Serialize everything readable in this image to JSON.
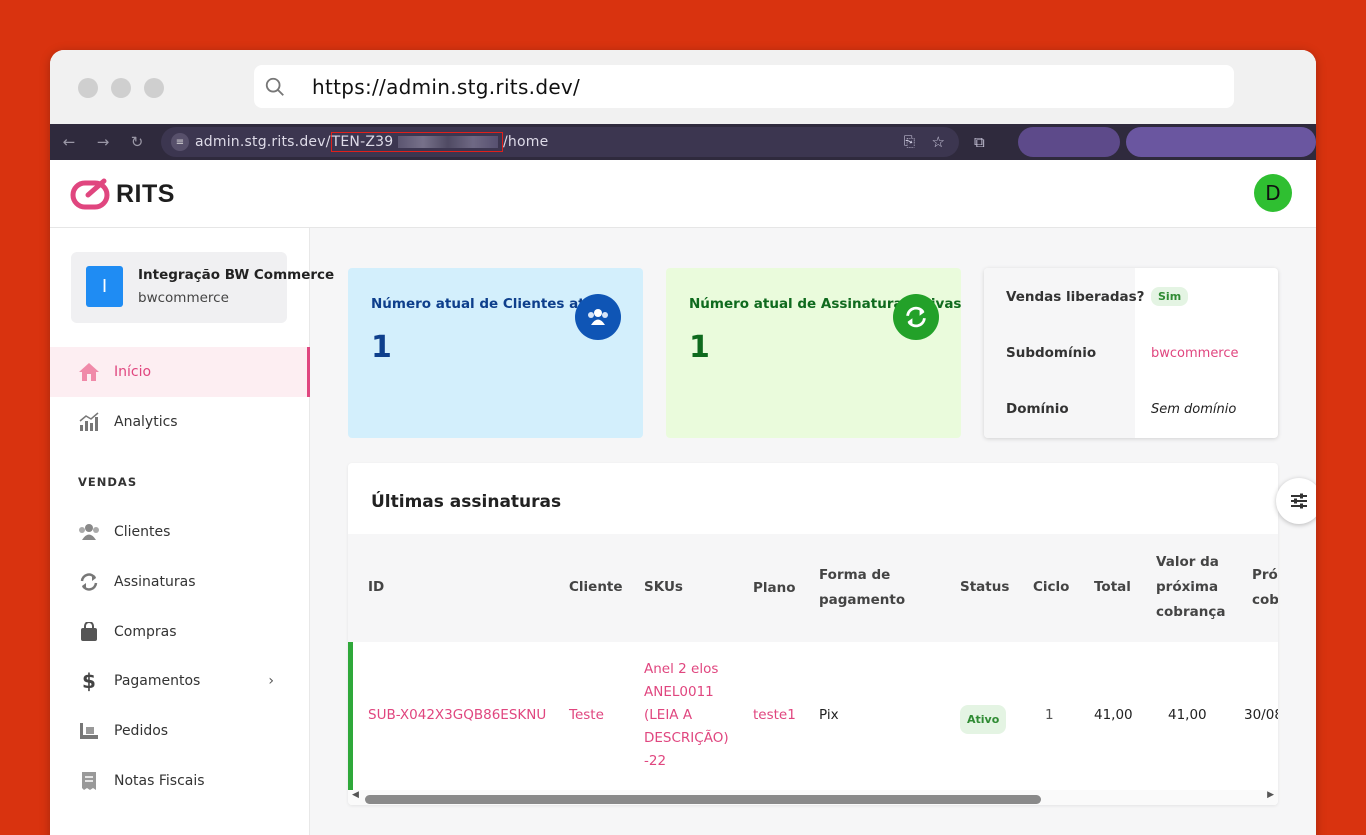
{
  "browser": {
    "url": "https://admin.stg.rits.dev/",
    "address_prefix": "admin.stg.rits.dev/",
    "address_tenant": "TEN-Z39",
    "address_suffix": "/home"
  },
  "header": {
    "logo_text": "RITS",
    "avatar_initial": "D"
  },
  "store": {
    "initial": "I",
    "name": "Integração BW Commerce",
    "slug": "bwcommerce"
  },
  "sidebar": {
    "items": [
      {
        "label": "Início",
        "icon": "home-icon"
      },
      {
        "label": "Analytics",
        "icon": "analytics-icon"
      }
    ],
    "section_vendas": "VENDAS",
    "vendas_items": [
      {
        "label": "Clientes",
        "icon": "users-icon"
      },
      {
        "label": "Assinaturas",
        "icon": "repeat-icon"
      },
      {
        "label": "Compras",
        "icon": "shopping-bag-icon"
      },
      {
        "label": "Pagamentos",
        "icon": "dollar-icon"
      },
      {
        "label": "Pedidos",
        "icon": "register-icon"
      },
      {
        "label": "Notas Fiscais",
        "icon": "receipt-icon"
      }
    ]
  },
  "cards": {
    "clientes": {
      "label": "Número atual de Clientes ativos",
      "value": "1"
    },
    "assinaturas": {
      "label": "Número atual de Assinaturas ativas",
      "value": "1"
    }
  },
  "info": {
    "vendas_label": "Vendas liberadas?",
    "vendas_value": "Sim",
    "subdominio_label": "Subdomínio",
    "subdominio_value": "bwcommerce",
    "dominio_label": "Domínio",
    "dominio_value": "Sem domínio"
  },
  "table": {
    "title": "Últimas assinaturas",
    "headers": {
      "id": "ID",
      "cliente": "Cliente",
      "skus": "SKUs",
      "plano": "Plano",
      "forma1": "Forma de",
      "forma2": "pagamento",
      "status": "Status",
      "ciclo": "Ciclo",
      "total": "Total",
      "valor1": "Valor da",
      "valor2": "próxima",
      "valor3": "cobrança",
      "prox1": "Próx",
      "prox2": "cobr"
    },
    "row": {
      "id": "SUB-X042X3GQB86ESKNU",
      "cliente": "Teste",
      "sku1": "Anel 2 elos",
      "sku2": "ANEL0011",
      "sku3": "(LEIA A",
      "sku4": "DESCRIÇÃO)",
      "sku5": "-22",
      "plano": "teste1",
      "forma": "Pix",
      "status": "Ativo",
      "ciclo": "1",
      "total": "41,00",
      "valor": "41,00",
      "prox": "30/08"
    }
  },
  "colors": {
    "accent": "#e0467f",
    "background": "#d9330f",
    "card_blue": "#d3effc",
    "card_green": "#eafbdc"
  }
}
